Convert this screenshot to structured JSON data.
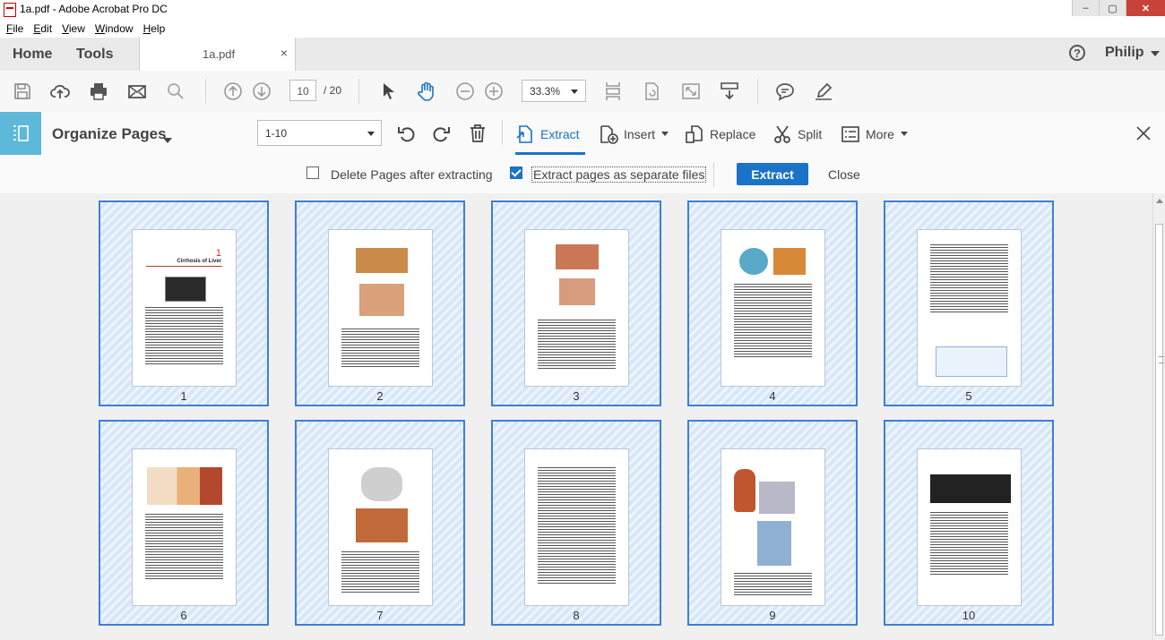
{
  "window": {
    "title": "1a.pdf - Adobe Acrobat Pro DC",
    "controls": [
      "–",
      "▢",
      "✕"
    ]
  },
  "menu": [
    {
      "key": "F",
      "rest": "ile"
    },
    {
      "key": "E",
      "rest": "dit"
    },
    {
      "key": "V",
      "rest": "iew"
    },
    {
      "key": "W",
      "rest": "indow"
    },
    {
      "key": "H",
      "rest": "elp"
    }
  ],
  "tabs": {
    "home": "Home",
    "tools": "Tools",
    "document": "1a.pdf",
    "close": "×"
  },
  "user": {
    "help": "?",
    "name": "Philip"
  },
  "toolbar": {
    "current_page": "10",
    "total_pages": "/ 20",
    "zoom": "33.3%"
  },
  "organize": {
    "title": "Organize Pages",
    "range": "1-10",
    "extract": "Extract",
    "insert": "Insert",
    "replace": "Replace",
    "split": "Split",
    "more": "More"
  },
  "options": {
    "delete_after": "Delete Pages after extracting",
    "delete_after_checked": false,
    "separate_files": "Extract pages as separate files",
    "separate_files_checked": true,
    "extract_button": "Extract",
    "close": "Close"
  },
  "pages": [
    {
      "number": "1",
      "chapter": "1",
      "heading": "Cirrhosis of Liver"
    },
    {
      "number": "2"
    },
    {
      "number": "3"
    },
    {
      "number": "4"
    },
    {
      "number": "5"
    },
    {
      "number": "6"
    },
    {
      "number": "7"
    },
    {
      "number": "8"
    },
    {
      "number": "9"
    },
    {
      "number": "10"
    }
  ],
  "colors": {
    "accent": "#1a73c7",
    "organize_icon_bg": "#5db8d9",
    "selection_border": "#3d7fd6",
    "selection_fill": "#d7e7f8"
  }
}
